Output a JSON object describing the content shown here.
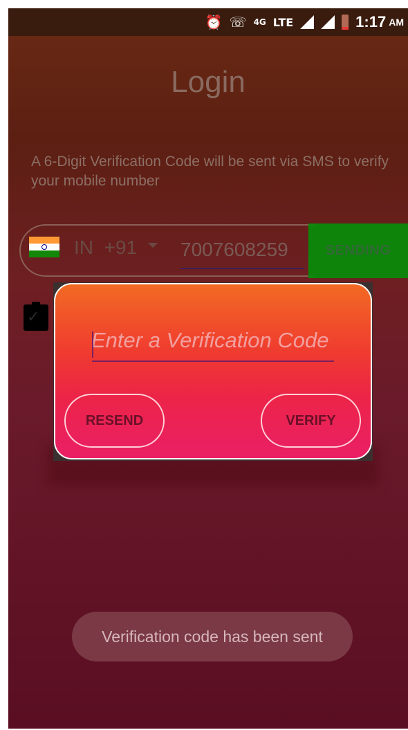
{
  "status_bar": {
    "icons": [
      "alarm-icon",
      "wifi-calling-icon",
      "4g-icon",
      "lte-icon",
      "signal-icon",
      "signal-icon",
      "battery-icon"
    ],
    "network_label": "4G",
    "lte_label": "LTE",
    "time": "1:17",
    "ampm": "AM"
  },
  "screen": {
    "title": "Login",
    "info_text": "A 6-Digit Verification Code will be sent via SMS to verify your mobile number"
  },
  "phone_input": {
    "country_code": "IN",
    "dial_code": "+91",
    "number": "7007608259",
    "send_button_label": "SENDING"
  },
  "dialog": {
    "code_placeholder": "Enter a Verification Code",
    "resend_label": "RESEND",
    "verify_label": "VERIFY"
  },
  "toast": {
    "message": "Verification code has been sent"
  },
  "colors": {
    "send_button": "#0a8a0a",
    "dialog_top": "#f26a23",
    "dialog_bottom": "#ea1f66"
  }
}
